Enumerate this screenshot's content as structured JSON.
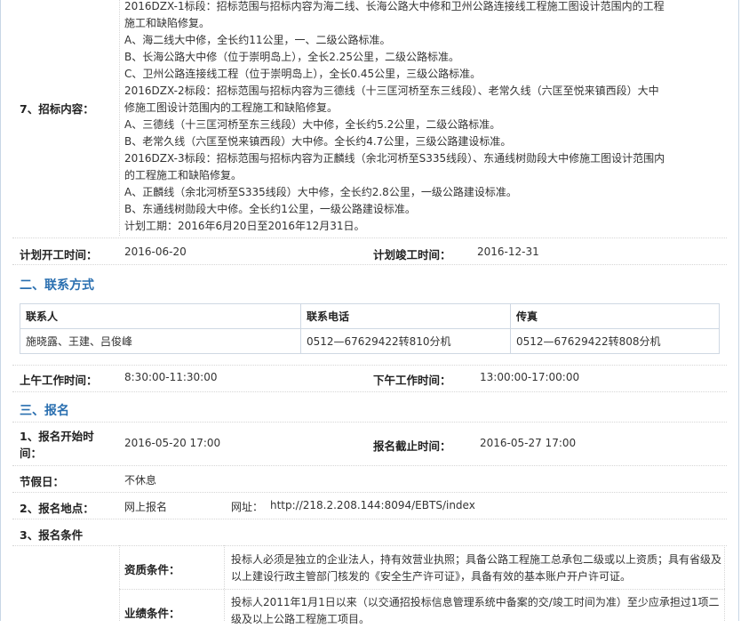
{
  "tender_content": {
    "label": "7、招标内容：",
    "lines": [
      "2016DZX-1标段：招标范围与招标内容为海二线、长海公路大中修和卫州公路连接线工程施工图设计范围内的工程",
      "施工和缺陷修复。",
      "A、海二线大中修，全长约11公里，一、二级公路标准。",
      "B、长海公路大中修（位于崇明岛上），全长2.25公里，二级公路标准。",
      "C、卫州公路连接线工程（位于崇明岛上），全长0.45公里，三级公路标准。",
      "2016DZX-2标段：招标范围与招标内容为三德线（十三匡河桥至东三线段）、老常久线（六匡至悦来镇西段）大中",
      "修施工图设计范围内的工程施工和缺陷修复。",
      "A、三德线（十三匡河桥至东三线段）大中修，全长约5.2公里，二级公路标准。",
      "B、老常久线（六匡至悦来镇西段）大中修。全长约4.7公里，三级公路建设标准。",
      "2016DZX-3标段：招标范围与招标内容为正麟线（余北河桥至S335线段）、东通线树勋段大中修施工图设计范围内",
      "的工程施工和缺陷修复。",
      "A、正麟线（余北河桥至S335线段）大中修，全长约2.8公里，一级公路建设标准。",
      "B、东通线树勋段大中修。全长约1公里，一级公路建设标准。",
      "计划工期：2016年6月20日至2016年12月31日。"
    ]
  },
  "plan": {
    "start_label": "计划开工时间：",
    "start_value": "2016-06-20",
    "end_label": "计划竣工时间：",
    "end_value": "2016-12-31"
  },
  "contact_section": {
    "title": "二、联系方式",
    "headers": [
      "联系人",
      "联系电话",
      "传真"
    ],
    "row": [
      "施晓露、王建、吕俊峰",
      "0512—67629422转810分机",
      "0512—67629422转808分机"
    ]
  },
  "work_hours": {
    "am_label": "上午工作时间：",
    "am_value": "8:30:00-11:30:00",
    "pm_label": "下午工作时间：",
    "pm_value": "13:00:00-17:00:00"
  },
  "registration": {
    "title": "三、报名",
    "start_label": "1、报名开始时间：",
    "start_value": "2016-05-20 17:00",
    "deadline_label": "报名截止时间：",
    "deadline_value": "2016-05-27 17:00",
    "holiday_label": "节假日：",
    "holiday_value": "不休息",
    "place_label": "2、报名地点：",
    "place_value": "网上报名",
    "url_label": "网址：",
    "url_value": "http://218.2.208.144:8094/EBTS/index",
    "conditions_label": "3、报名条件",
    "qualification_label": "资质条件：",
    "qualification_text": "投标人必须是独立的企业法人，持有效营业执照；具备公路工程施工总承包二级或以上资质；具有省级及以上建设行政主管部门核发的《安全生产许可证》，具备有效的基本账户开户许可证。",
    "performance_label": "业绩条件：",
    "performance_text": "投标人2011年1月1日以来（以交通招投标信息管理系统中备案的交/竣工时间为准）至少应承担过1项二级及以上公路工程施工项目。"
  }
}
